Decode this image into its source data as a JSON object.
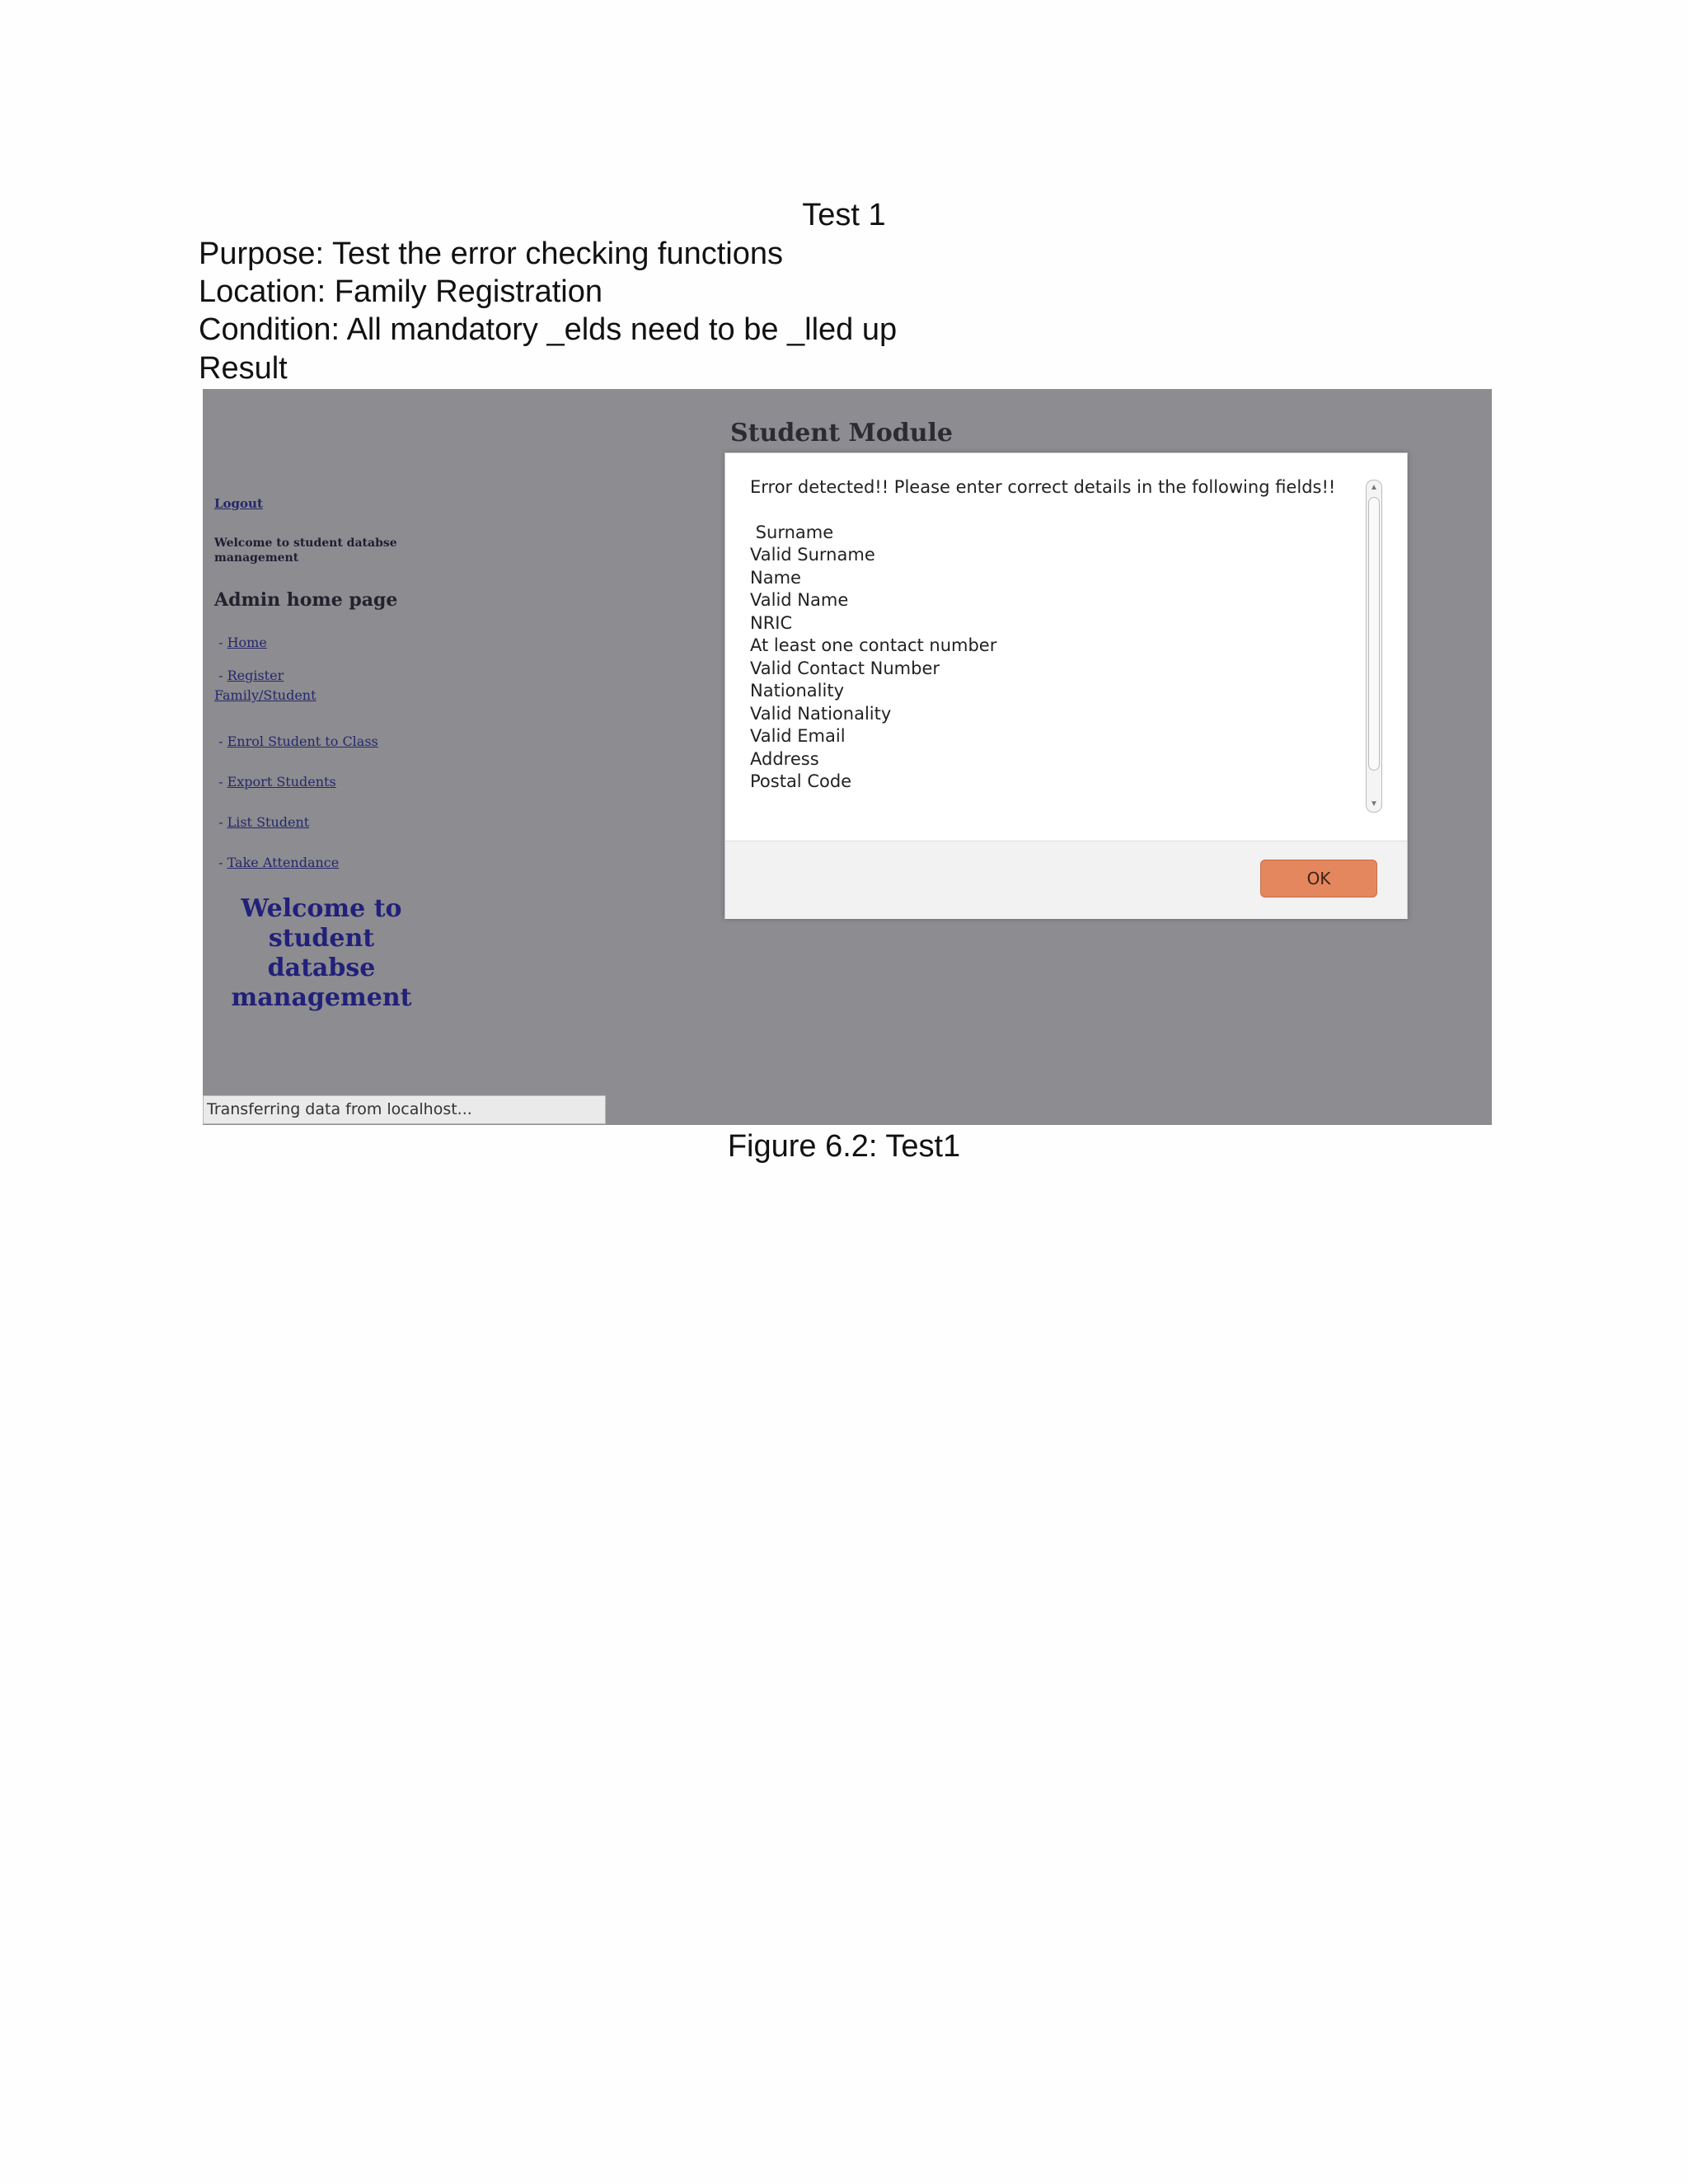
{
  "document": {
    "title": "Test 1",
    "purpose": "Purpose: Test the error checking functions",
    "location": "Location: Family Registration",
    "condition": "Condition: All mandatory _elds need to be _lled up",
    "result_label": "Result",
    "caption": "Figure 6.2: Test1"
  },
  "screenshot": {
    "sidebar": {
      "logout": "Logout",
      "welcome_small": "Welcome to student databse management",
      "admin_heading": "Admin home page",
      "nav_items": [
        {
          "prefix": "- ",
          "label": "Home"
        },
        {
          "prefix": "- ",
          "label": "Register Family/Student"
        },
        {
          "prefix": "- ",
          "label": "Enrol Student to Class"
        },
        {
          "prefix": "- ",
          "label": "Export Students"
        },
        {
          "prefix": "- ",
          "label": "List Student"
        },
        {
          "prefix": "- ",
          "label": "Take Attendance"
        }
      ],
      "welcome_big": "Welcome to student databse management"
    },
    "module_title": "Student Module",
    "dialog": {
      "intro": "Error detected!! Please enter correct details in the following fields!!",
      "errors": [
        " Surname",
        "Valid Surname",
        "Name",
        "Valid Name",
        "NRIC",
        "At least one contact number",
        "Valid Contact Number",
        "Nationality",
        "Valid Nationality",
        "Valid Email",
        "Address",
        "Postal Code"
      ],
      "ok_label": "OK"
    },
    "status_bar": "Transferring data from localhost..."
  },
  "colors": {
    "overlay": "#8d8c90",
    "ok_button": "#e4875e",
    "link": "#25276b"
  },
  "icons": {
    "scroll_up": "scroll-up-arrow-icon",
    "scroll_down": "scroll-down-arrow-icon"
  }
}
